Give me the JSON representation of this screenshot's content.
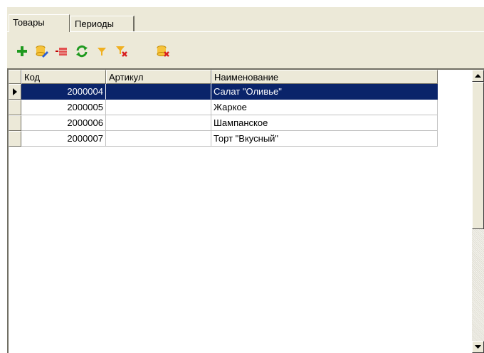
{
  "tabs": [
    {
      "label": "Товары",
      "active": true
    },
    {
      "label": "Периоды",
      "active": false
    }
  ],
  "toolbar": [
    {
      "icon": "add-icon"
    },
    {
      "icon": "edit-db-icon"
    },
    {
      "icon": "delete-icon"
    },
    {
      "icon": "refresh-icon"
    },
    {
      "icon": "filter-icon"
    },
    {
      "icon": "clear-filter-icon"
    },
    {
      "icon": "delete-db-icon"
    }
  ],
  "grid": {
    "columns": [
      "Код",
      "Артикул",
      "Наименование"
    ],
    "rows": [
      {
        "code": "2000004",
        "article": "",
        "name": "Салат \"Оливье\"",
        "selected": true
      },
      {
        "code": "2000005",
        "article": "",
        "name": "Жаркое",
        "selected": false
      },
      {
        "code": "2000006",
        "article": "",
        "name": "Шампанское",
        "selected": false
      },
      {
        "code": "2000007",
        "article": "",
        "name": "Торт \"Вкусный\"",
        "selected": false
      }
    ]
  },
  "colors": {
    "selection": "#0a246a",
    "window": "#ece9d8"
  }
}
